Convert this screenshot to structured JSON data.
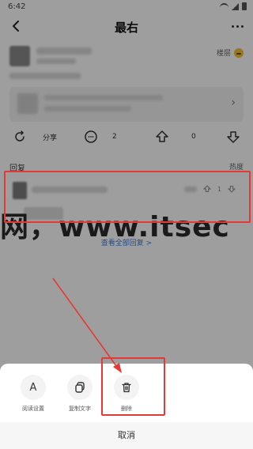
{
  "status_bar": {
    "time": "6:42"
  },
  "header": {
    "title": "最右"
  },
  "post": {
    "mood_label": "楼层"
  },
  "actions": {
    "share_label": "分享",
    "comment_count": "2",
    "upvote_count": "0"
  },
  "replies": {
    "section_title": "回复",
    "sort_label": "热度",
    "reply_meta_count": "1",
    "view_all": "查看全部回复 >"
  },
  "watermark": {
    "text": "网，www.itsec"
  },
  "sheet": {
    "options": [
      {
        "label": "阅读设置"
      },
      {
        "label": "复制文字"
      },
      {
        "label": "删除"
      }
    ],
    "cancel_label": "取消"
  },
  "colors": {
    "highlight": "#e53935",
    "link": "#3d7dd8"
  },
  "icons": [
    "back-icon",
    "more-icon",
    "share-icon",
    "comment-icon",
    "upvote-icon",
    "downvote-icon",
    "font-icon",
    "copy-icon",
    "trash-icon"
  ]
}
